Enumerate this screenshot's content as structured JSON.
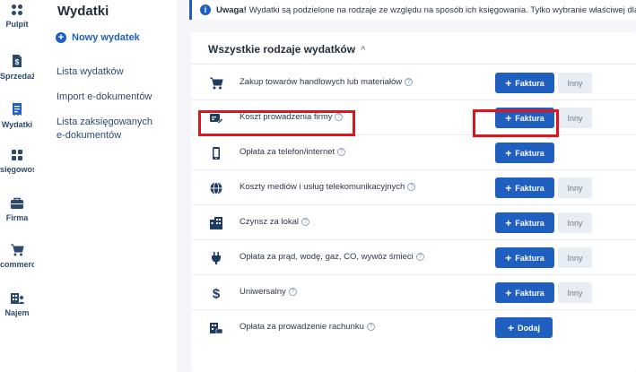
{
  "rail": {
    "items": [
      {
        "label": "Pulpit",
        "icon": "dashboard-icon"
      },
      {
        "label": "Sprzedaż",
        "icon": "document-dollar-icon"
      },
      {
        "label": "Wydatki",
        "icon": "receipt-icon"
      },
      {
        "label": "sięgowość",
        "icon": "grid-icon"
      },
      {
        "label": "Firma",
        "icon": "briefcase-icon"
      },
      {
        "label": "commerce",
        "icon": "cart-icon"
      },
      {
        "label": "Najem",
        "icon": "building-icon"
      }
    ]
  },
  "sidebar": {
    "title": "Wydatki",
    "new_label": "Nowy wydatek",
    "links": [
      "Lista wydatków",
      "Import e-dokumentów",
      "Lista zaksięgowanych",
      "e-dokumentów"
    ]
  },
  "alert": {
    "strong": "Uwaga!",
    "message": "Wydatki są podzielone na rodzaje ze względu na sposób ich księgowania. Tylko wybranie właściwej dla d"
  },
  "card": {
    "title": "Wszystkie rodzaje wydatków",
    "rows": [
      {
        "label": "Zakup towarów handlowych lub materiałów",
        "icon": "cart-icon",
        "primary": "Faktura",
        "secondary": "Inny"
      },
      {
        "label": "Koszt prowadzenia firmy",
        "icon": "card-edit-icon",
        "primary": "Faktura",
        "secondary": "Inny"
      },
      {
        "label": "Opłata za telefon/internet",
        "icon": "phone-icon",
        "primary": "Faktura",
        "secondary": ""
      },
      {
        "label": "Koszty mediów i usług telekomunikacyjnych",
        "icon": "globe-icon",
        "primary": "Faktura",
        "secondary": "Inny"
      },
      {
        "label": "Czynsz za lokal",
        "icon": "building-icon",
        "primary": "Faktura",
        "secondary": "Inny"
      },
      {
        "label": "Opłata za prąd, wodę, gaz, CO, wywóz śmieci",
        "icon": "plug-icon",
        "primary": "Faktura",
        "secondary": "Inny"
      },
      {
        "label": "Uniwersalny",
        "icon": "dollar-icon",
        "primary": "Faktura",
        "secondary": "Inny"
      },
      {
        "label": "Opłata za prowadzenie rachunku",
        "icon": "bank-icon",
        "primary": "Dodaj",
        "secondary": ""
      }
    ]
  },
  "help_glyph": "?",
  "plus_glyph": "+",
  "chevron_glyph": "^",
  "info_glyph": "i",
  "colors": {
    "primary": "#1f5fbf",
    "highlight": "#e0141f",
    "text_dark": "#1f2d3d"
  }
}
